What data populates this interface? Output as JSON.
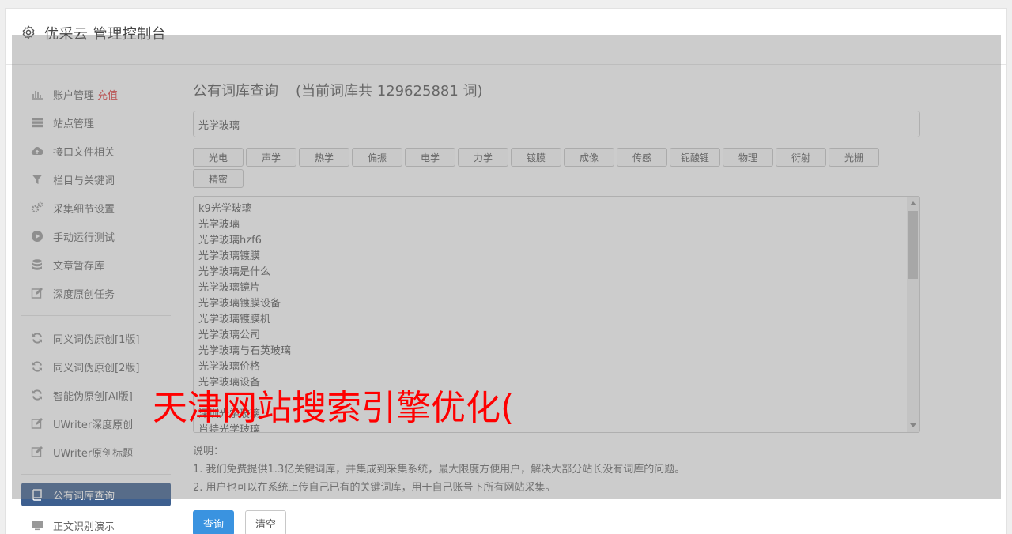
{
  "app": {
    "title": "优采云 管理控制台"
  },
  "sidebar": {
    "groups": [
      [
        {
          "label": "账户管理",
          "badge": "充值",
          "icon": "bar-chart-icon"
        },
        {
          "label": "站点管理",
          "icon": "server-icon"
        },
        {
          "label": "接口文件相关",
          "icon": "cloud-upload-icon"
        },
        {
          "label": "栏目与关键词",
          "icon": "filter-icon"
        },
        {
          "label": "采集细节设置",
          "icon": "gears-icon"
        },
        {
          "label": "手动运行测试",
          "icon": "play-circle-icon"
        },
        {
          "label": "文章暂存库",
          "icon": "database-icon"
        },
        {
          "label": "深度原创任务",
          "icon": "edit-icon"
        }
      ],
      [
        {
          "label": "同义词伪原创[1版]",
          "icon": "refresh-icon"
        },
        {
          "label": "同义词伪原创[2版]",
          "icon": "refresh-icon"
        },
        {
          "label": "智能伪原创[AI版]",
          "icon": "refresh-icon"
        },
        {
          "label": "UWriter深度原创",
          "icon": "edit-icon"
        },
        {
          "label": "UWriter原创标题",
          "icon": "edit-icon"
        }
      ],
      [
        {
          "label": "公有词库查询",
          "icon": "book-icon",
          "active": true
        },
        {
          "label": "正文识别演示",
          "icon": "monitor-icon"
        }
      ]
    ]
  },
  "main": {
    "title": "公有词库查询",
    "count_text": "(当前词库共 129625881 词)",
    "search_value": "光学玻璃",
    "categories": [
      "光电",
      "声学",
      "热学",
      "偏振",
      "电学",
      "力学",
      "镀膜",
      "成像",
      "传感",
      "铌酸锂",
      "物理",
      "衍射",
      "光栅",
      "精密"
    ],
    "results": [
      "k9光学玻璃",
      "光学玻璃",
      "光学玻璃hzf6",
      "光学玻璃镀膜",
      "光学玻璃是什么",
      "光学玻璃镜片",
      "光学玻璃镀膜设备",
      "光学玻璃镀膜机",
      "光学玻璃公司",
      "光学玻璃与石英玻璃",
      "光学玻璃价格",
      "光学玻璃设备",
      "",
      "深圳光学玻璃",
      "肖特光学玻璃"
    ],
    "notes": {
      "heading": "说明：",
      "lines": [
        "1. 我们免费提供1.3亿关键词库，并集成到采集系统，最大限度方便用户，解决大部分站长没有词库的问题。",
        "2. 用户也可以在系统上传自己已有的关键词库，用于自己账号下所有网站采集。"
      ]
    },
    "buttons": {
      "query": "查询",
      "clear": "清空"
    }
  },
  "watermark": "天津网站搜索引擎优化("
}
